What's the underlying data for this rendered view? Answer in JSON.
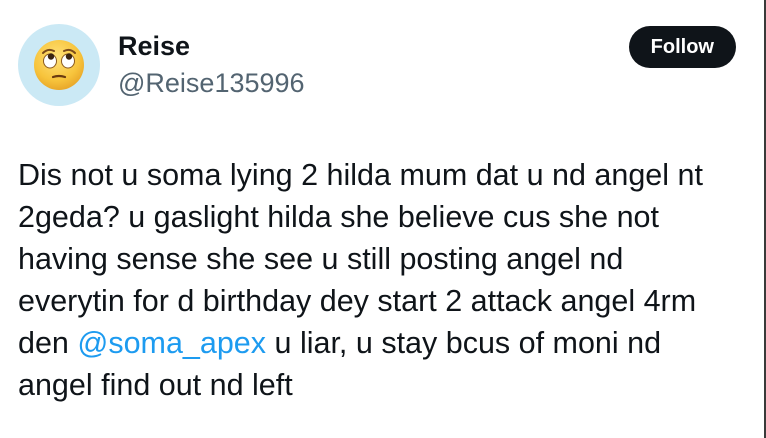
{
  "user": {
    "display_name": "Reise",
    "handle": "@Reise135996",
    "avatar_icon": "face-with-rolling-eyes-emoji",
    "avatar_bg": "#cbe9f5"
  },
  "follow_button": {
    "label": "Follow"
  },
  "tweet": {
    "line1": "Dis not u soma lying 2 hilda mum dat u nd angel nt",
    "line2": "2geda? u gaslight hilda she believe cus she not",
    "line3": "having sense she see u still posting angel nd",
    "line4": "everytin for d birthday dey start 2 attack angel 4rm",
    "line5_prefix": "den ",
    "mention": "@soma_apex",
    "line5_suffix": " u liar, u stay bcus of moni nd",
    "line6": "angel find out nd left"
  },
  "colors": {
    "text": "#0f1419",
    "secondary": "#536471",
    "link": "#1d9bf0",
    "button_bg": "#0f1419"
  }
}
